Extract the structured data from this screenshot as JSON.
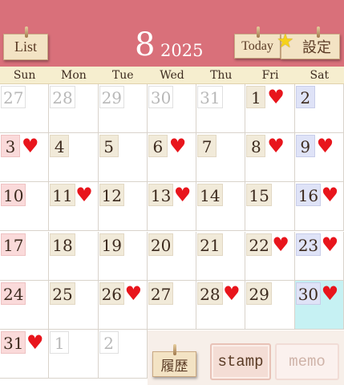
{
  "header": {
    "list_label": "List",
    "month": "8",
    "year": "2025",
    "today_label": "Today",
    "settings_label": "設定"
  },
  "weekdays": [
    "Sun",
    "Mon",
    "Tue",
    "Wed",
    "Thu",
    "Fri",
    "Sat"
  ],
  "weeks": [
    [
      {
        "d": "27",
        "out": true
      },
      {
        "d": "28",
        "out": true
      },
      {
        "d": "29",
        "out": true
      },
      {
        "d": "30",
        "out": true
      },
      {
        "d": "31",
        "out": true
      },
      {
        "d": "1",
        "heart": true
      },
      {
        "d": "2"
      }
    ],
    [
      {
        "d": "3",
        "heart": true
      },
      {
        "d": "4"
      },
      {
        "d": "5"
      },
      {
        "d": "6",
        "heart": true
      },
      {
        "d": "7"
      },
      {
        "d": "8",
        "heart": true
      },
      {
        "d": "9",
        "heart": true
      }
    ],
    [
      {
        "d": "10"
      },
      {
        "d": "11",
        "heart": true
      },
      {
        "d": "12"
      },
      {
        "d": "13",
        "heart": true
      },
      {
        "d": "14"
      },
      {
        "d": "15"
      },
      {
        "d": "16",
        "heart": true
      }
    ],
    [
      {
        "d": "17"
      },
      {
        "d": "18"
      },
      {
        "d": "19"
      },
      {
        "d": "20"
      },
      {
        "d": "21"
      },
      {
        "d": "22",
        "heart": true
      },
      {
        "d": "23",
        "heart": true
      }
    ],
    [
      {
        "d": "24"
      },
      {
        "d": "25"
      },
      {
        "d": "26",
        "heart": true
      },
      {
        "d": "27"
      },
      {
        "d": "28",
        "heart": true
      },
      {
        "d": "29"
      },
      {
        "d": "30",
        "heart": true,
        "today": true
      }
    ],
    [
      {
        "d": "31",
        "heart": true
      },
      {
        "d": "1",
        "out": true
      },
      {
        "d": "2",
        "out": true
      }
    ]
  ],
  "heart_symbol": "♥",
  "bottom": {
    "history_label": "履歴",
    "stamp_label": "stamp",
    "memo_label": "memo"
  },
  "colors": {
    "header": "#d9707a",
    "heart": "#e8151c",
    "today_highlight": "#c6f1f3"
  }
}
